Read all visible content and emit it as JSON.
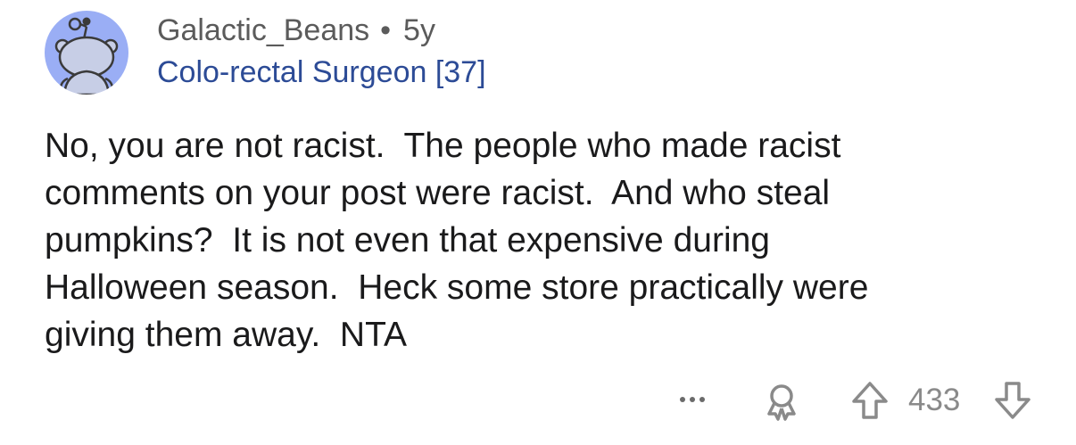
{
  "comment": {
    "username": "Galactic_Beans",
    "separator": "•",
    "age": "5y",
    "flair": "Colo-rectal Surgeon [37]",
    "body": "No, you are not racist.  The people who made racist\ncomments on your post were racist.  And who steal\npumpkins?  It is not even that expensive during\nHalloween season.  Heck some store practically were\ngiving them away.  NTA"
  },
  "actions": {
    "score": "433",
    "icons": {
      "more": "more-options-icon",
      "award": "award-icon",
      "upvote": "upvote-arrow-icon",
      "downvote": "downvote-arrow-icon"
    }
  },
  "colors": {
    "avatar_bg": "#9aaef5",
    "username": "#5b5b5b",
    "flair": "#2c4b96",
    "body_text": "#1a1a1b",
    "action_icons": "#8a8a8a"
  }
}
